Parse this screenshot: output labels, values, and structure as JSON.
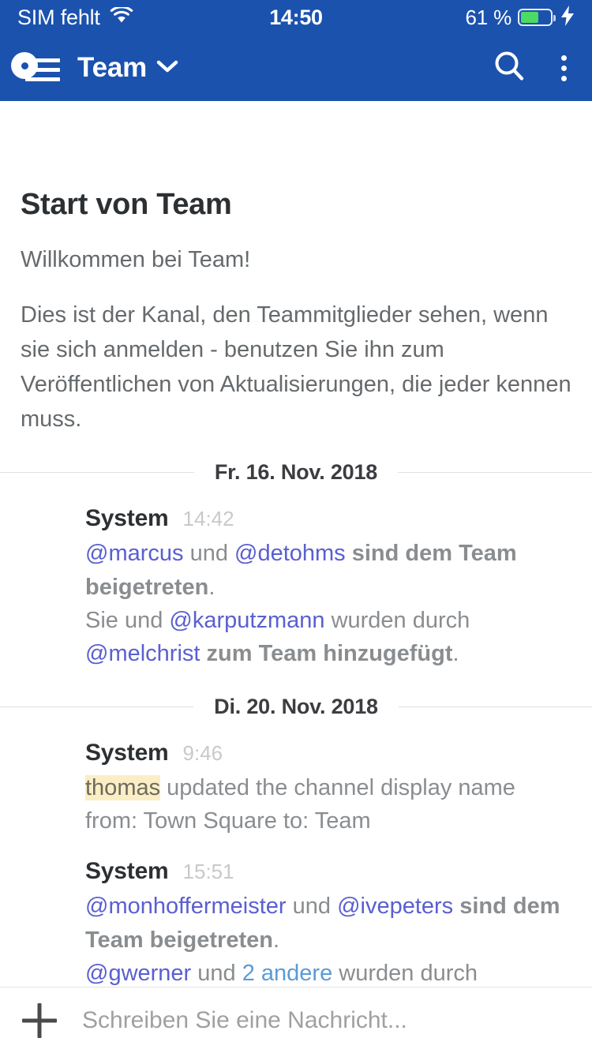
{
  "status_bar": {
    "carrier": "SIM fehlt",
    "wifi_icon": "wifi-icon",
    "time": "14:50",
    "battery_percent_label": "61 %",
    "battery_level": 61,
    "battery_color": "#4cd964",
    "charging_icon": "lightning-bolt-icon"
  },
  "nav_bar": {
    "menu_icon": "hamburger-menu-icon",
    "status_indicator": "online-status-dot",
    "title": "Team",
    "dropdown_icon": "chevron-down-icon",
    "search_icon": "search-icon",
    "overflow_icon": "more-vertical-icon",
    "background_color": "#1b52ae"
  },
  "intro": {
    "title": "Start von Team",
    "welcome": "Willkommen bei Team!",
    "body": "Dies ist der Kanal, den Teammitglieder sehen, wenn sie sich anmelden - benutzen Sie ihn zum Veröffentlichen von Aktualisierungen, die jeder kennen muss."
  },
  "dividers": {
    "first": "Fr. 16. Nov. 2018",
    "second": "Di. 20. Nov. 2018"
  },
  "messages": [
    {
      "author": "System",
      "time": "14:42",
      "line1": {
        "mention1": "@marcus",
        "conj": " und ",
        "mention2": "@detohms",
        "tail_bold": " sind dem Team beigetreten",
        "period": "."
      },
      "line2": {
        "prefix": "Sie und ",
        "mention1": "@karputzmann",
        "mid": " wurden durch ",
        "mention2": "@melchrist",
        "tail_bold": " zum Team hinzugefügt",
        "period": "."
      }
    },
    {
      "author": "System",
      "time": "9:46",
      "highlight_name": "thomas",
      "text": " updated the channel display name from: Town Square to: Team"
    },
    {
      "author": "System",
      "time": "15:51",
      "line1": {
        "mention1": "@monhoffermeister",
        "conj": " und ",
        "mention2": "@ivepeters",
        "tail_bold": " sind dem Team beigetreten",
        "period": "."
      },
      "line2": {
        "mention1": "@gwerner",
        "conj": " und ",
        "link": "2 andere",
        "tail": " wurden durch"
      }
    }
  ],
  "input_bar": {
    "add_icon": "plus-icon",
    "placeholder": "Schreiben Sie eine Nachricht...",
    "value": ""
  },
  "colors": {
    "brand_blue": "#1b52ae",
    "mention": "#5a5fd0",
    "link": "#5b9bd5",
    "highlight_bg": "#fbeec4"
  }
}
